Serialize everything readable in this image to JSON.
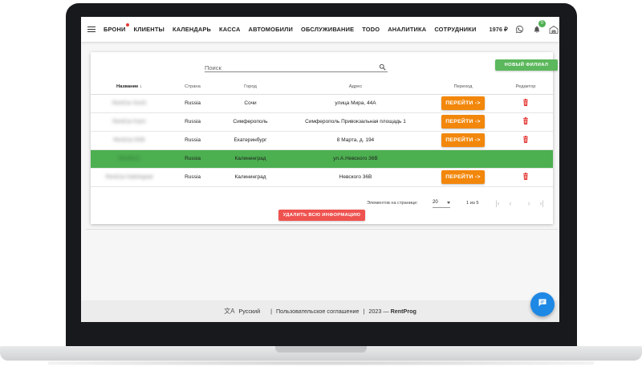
{
  "nav": {
    "links": [
      "БРОНИ",
      "КЛИЕНТЫ",
      "КАЛЕНДАРЬ",
      "КАССА",
      "АВТОМОБИЛИ",
      "ОБСЛУЖИВАНИЕ",
      "TODO",
      "АНАЛИТИКА",
      "СОТРУДНИКИ"
    ],
    "balance": "1976 ₽",
    "notifications_count": "0"
  },
  "toolbar": {
    "search_placeholder": "Поиск",
    "new_branch_label": "НОВЫЙ ФИЛИАЛ"
  },
  "table": {
    "headers": [
      "Название",
      "Страна",
      "Город",
      "Адрес",
      "Переход",
      "Редактор"
    ],
    "rows": [
      {
        "name": "RentCar Sochi",
        "country": "Russia",
        "city": "Сочи",
        "address": "улица Мира, 44А",
        "go_label": "ПЕРЕЙТИ ->",
        "selected": false
      },
      {
        "name": "RentCar Krym",
        "country": "Russia",
        "city": "Симферополь",
        "address": "Симферополь Привокзальная площадь 1",
        "go_label": "ПЕРЕЙТИ ->",
        "selected": false
      },
      {
        "name": "RentCar EKB",
        "country": "Russia",
        "city": "Екатеринбург",
        "address": "8 Марта, д. 194",
        "go_label": "ПЕРЕЙТИ ->",
        "selected": false
      },
      {
        "name": "RentKLD",
        "country": "Russia",
        "city": "Калининград",
        "address": "ул.А.Невского 36В",
        "go_label": "",
        "selected": true
      },
      {
        "name": "RentCar Kaliningrad",
        "country": "Russia",
        "city": "Калининград",
        "address": "Невского 36В",
        "go_label": "ПЕРЕЙТИ ->",
        "selected": false
      }
    ]
  },
  "pagination": {
    "per_page_label": "Элементов на странице:",
    "per_page_value": "20",
    "range": "1 из 5"
  },
  "delete_all_label": "УДАЛИТЬ ВСЮ ИНФОРМАЦИЮ",
  "footer": {
    "language": "Русский",
    "agreement": "Пользовательское соглашение",
    "year": "2023 —",
    "brand": "RentProg"
  },
  "colors": {
    "accent_green": "#4caf50",
    "button_orange": "#f2870b",
    "danger_red": "#ef5350",
    "chat_blue": "#1e88e5"
  }
}
